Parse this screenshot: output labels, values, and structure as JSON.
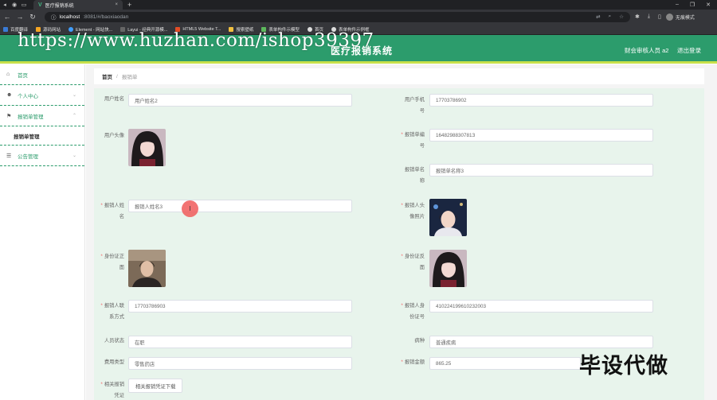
{
  "browser": {
    "tab_title": "医疗报销系统",
    "url_host": "localhost",
    "url_path": ":8081/#/baoxiaodan",
    "profile_label": "无痕模式",
    "bookmarks": [
      "百度翻译",
      "源码网站",
      "Element - 网站快...",
      "Layui - 经典开源模...",
      "HTML5 Website T...",
      "搜索壁纸",
      "表单构件示模型",
      "首页",
      "表单构件示例框"
    ]
  },
  "header": {
    "system_title": "医疗报销系统",
    "user_label": "财会审核人员 a2",
    "logout_label": "退出登录",
    "watermark": "https://www.huzhan.com/ishop39397"
  },
  "sidebar": {
    "items": [
      {
        "label": "首页",
        "icon": "home-icon"
      },
      {
        "label": "个人中心",
        "icon": "user-icon"
      },
      {
        "label": "报销单管理",
        "icon": "flag-icon"
      },
      {
        "label": "报销单管理",
        "icon": ""
      },
      {
        "label": "公告管理",
        "icon": "list-icon"
      }
    ]
  },
  "breadcrumb": {
    "home": "首页",
    "separator": "/",
    "current": "报销单"
  },
  "form": {
    "user_name_label": "用户姓名",
    "user_name_value": "用户姓名2",
    "user_phone_label_1": "用户手机",
    "user_phone_label_2": "号",
    "user_phone_value": "17703786902",
    "user_avatar_label": "用户头像",
    "claim_no_label_1": "报销单编",
    "claim_no_label_2": "号",
    "claim_no_value": "1648298830781З",
    "claim_name_label_1": "报销单名",
    "claim_name_label_2": "称",
    "claim_name_value": "报销单名称3",
    "claimant_name_label_1": "报销人姓",
    "claimant_name_label_2": "名",
    "claimant_name_value": "报销人姓名3",
    "claimant_photo_label_1": "报销人头",
    "claimant_photo_label_2": "像照片",
    "id_front_label_1": "身份证正",
    "id_front_label_2": "面",
    "id_back_label_1": "身份证反",
    "id_back_label_2": "面",
    "claimant_phone_label_1": "报销人联",
    "claimant_phone_label_2": "系方式",
    "claimant_phone_value": "17703786903",
    "claimant_id_label_1": "报销人身",
    "claimant_id_label_2": "份证号",
    "claimant_id_value": "410224199610232003",
    "status_label": "人员状态",
    "status_value": "在职",
    "disease_label": "病种",
    "disease_value": "普通疾病",
    "fee_type_label": "费用类型",
    "fee_type_value": "零售药店",
    "amount_label": "报销金额",
    "amount_value": "865.25",
    "voucher_label_1": "相关报销",
    "voucher_label_2": "凭证",
    "voucher_button": "相关报销凭证下载"
  },
  "overlay": {
    "corner_text": "毕设代做",
    "cursor_glyph": "I"
  },
  "colors": {
    "brand_green": "#2c9c6c",
    "accent_yellow": "#c8e04a",
    "required_star": "#f56c6c"
  }
}
